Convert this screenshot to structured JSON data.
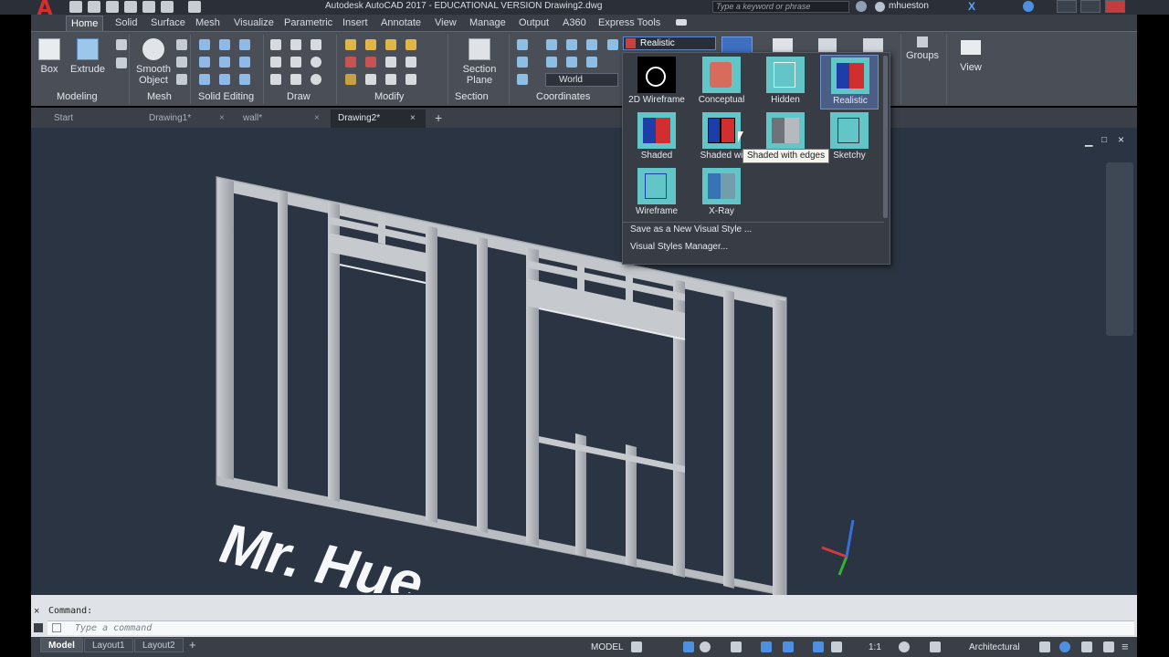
{
  "app": {
    "logo_letter": "A",
    "title": "Autodesk AutoCAD 2017 - EDUCATIONAL VERSION    Drawing2.dwg",
    "search_placeholder": "Type a keyword or phrase",
    "user_name": "mhueston"
  },
  "ribbon_tabs": [
    "Home",
    "Solid",
    "Surface",
    "Mesh",
    "Visualize",
    "Parametric",
    "Insert",
    "Annotate",
    "View",
    "Manage",
    "Output",
    "A360",
    "Express Tools"
  ],
  "active_tab": "Home",
  "ribbon": {
    "tools": {
      "box": "Box",
      "extrude": "Extrude",
      "smooth_object": "Smooth Object",
      "section_plane": "Section Plane",
      "groups": "Groups",
      "view": "View"
    },
    "panels": [
      "Modeling",
      "Mesh",
      "Solid Editing",
      "Draw",
      "Modify",
      "Section",
      "Coordinates"
    ],
    "visual_style_current": "Realistic",
    "ucs_current": "World"
  },
  "file_tabs": [
    {
      "label": "Start",
      "closable": false
    },
    {
      "label": "Drawing1*",
      "closable": true
    },
    {
      "label": "wall*",
      "closable": true
    },
    {
      "label": "Drawing2*",
      "closable": true,
      "active": true
    }
  ],
  "visual_styles_gallery": {
    "items": [
      {
        "name": "2D Wireframe",
        "icon": "2d-wireframe-icon"
      },
      {
        "name": "Conceptual",
        "icon": "conceptual-icon"
      },
      {
        "name": "Hidden",
        "icon": "hidden-icon"
      },
      {
        "name": "Realistic",
        "icon": "realistic-icon",
        "selected": true
      },
      {
        "name": "Shaded",
        "icon": "shaded-icon"
      },
      {
        "name": "Shaded wi",
        "icon": "shaded-with-edges-icon"
      },
      {
        "name": "",
        "icon": "shades-of-gray-icon"
      },
      {
        "name": "Sketchy",
        "icon": "sketchy-icon"
      },
      {
        "name": "Wireframe",
        "icon": "wireframe-icon"
      },
      {
        "name": "X-Ray",
        "icon": "x-ray-icon"
      }
    ],
    "menu": [
      "Save as a New Visual Style ...",
      "Visual Styles Manager..."
    ],
    "tooltip": "Shaded with edges"
  },
  "viewport": {
    "text_on_model": "Mr. Hue"
  },
  "command_line": {
    "label": "Command:",
    "placeholder": "Type a command"
  },
  "layout_tabs": [
    {
      "label": "Model",
      "active": true
    },
    {
      "label": "Layout1"
    },
    {
      "label": "Layout2"
    }
  ],
  "status_bar": {
    "space": "MODEL",
    "scale": "1:1",
    "units": "Architectural"
  },
  "colors": {
    "viewport_bg": "#2b3442",
    "ribbon_bg": "#4a4f57",
    "gallery_bg": "#383d45",
    "selection_blue": "#4b5e86",
    "thumb_cyan": "#62c6c8"
  }
}
